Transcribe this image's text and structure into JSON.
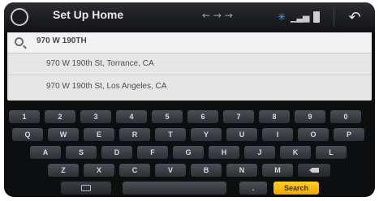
{
  "header": {
    "title": "Set Up Home",
    "mid_arrows": "← → →"
  },
  "search": {
    "value": "970 W 190TH"
  },
  "suggestions": [
    "970 W 190th St, Torrance, CA",
    "970 W 190th St, Los Angeles, CA"
  ],
  "keyboard": {
    "row1": [
      "1",
      "2",
      "3",
      "4",
      "5",
      "6",
      "7",
      "8",
      "9",
      "0"
    ],
    "row2": [
      "Q",
      "W",
      "E",
      "R",
      "T",
      "Y",
      "U",
      "I",
      "O",
      "P"
    ],
    "row3": [
      "A",
      "S",
      "D",
      "F",
      "G",
      "H",
      "J",
      "K",
      "L"
    ],
    "row4": [
      "Z",
      "X",
      "C",
      "V",
      "B",
      "N",
      "M"
    ],
    "period": ".",
    "search_label": "Search"
  },
  "colors": {
    "search_key": "#f5b400",
    "bluetooth": "#4aa3e0"
  }
}
